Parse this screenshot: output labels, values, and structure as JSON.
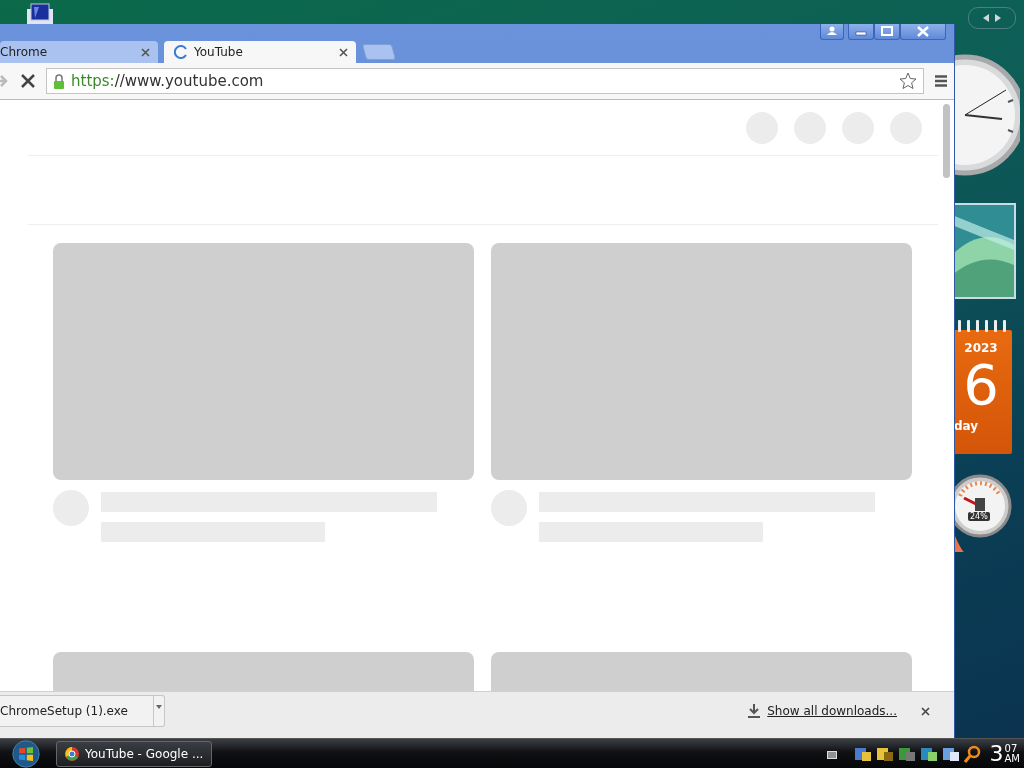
{
  "browser": {
    "tabs": [
      {
        "title": "Chrome",
        "selected": false,
        "loading": false
      },
      {
        "title": "YouTube",
        "selected": true,
        "loading": true
      }
    ],
    "address": {
      "url": "https://www.youtube.com",
      "secure": true,
      "loading": true
    },
    "downloads": {
      "items": [
        {
          "filename": "ChromeSetup (1).exe"
        }
      ],
      "show_all": "Show all downloads..."
    }
  },
  "taskbar": {
    "buttons": [
      {
        "label": "YouTube - Google ..."
      }
    ],
    "clock": {
      "hour": "3",
      "minute": "07",
      "period": "AM"
    }
  },
  "gadgets": {
    "calendar": {
      "year": "2023",
      "day": "6",
      "weekday": "day"
    },
    "cpu_meter": {
      "reading": "24%"
    }
  }
}
